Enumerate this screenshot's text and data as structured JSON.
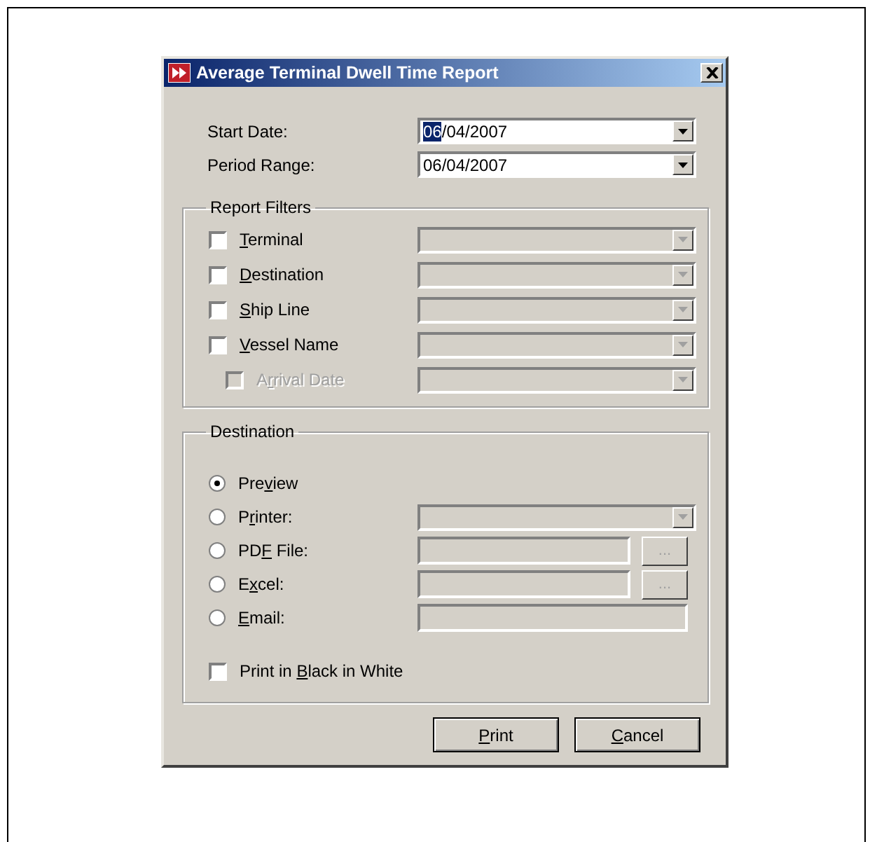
{
  "window": {
    "title": "Average Terminal Dwell Time Report"
  },
  "date_fields": [
    {
      "label": "Start Date:",
      "value_selected": "06",
      "value": "/04/2007"
    },
    {
      "label": "Period Range:",
      "value": "06/04/2007"
    }
  ],
  "report_filters": {
    "title": "Report Filters",
    "items": [
      {
        "label": {
          "key": "T",
          "post": "erminal"
        },
        "checked": false,
        "disabled": false
      },
      {
        "label": {
          "key": "D",
          "post": "estination"
        },
        "checked": false,
        "disabled": false
      },
      {
        "label": {
          "key": "S",
          "post": "hip Line"
        },
        "checked": false,
        "disabled": false
      },
      {
        "label": {
          "key": "V",
          "post": "essel Name"
        },
        "checked": false,
        "disabled": false,
        "children": [
          {
            "label": {
              "pre": "A",
              "key": "r",
              "post": "rival Date"
            },
            "checked": false,
            "disabled": true
          }
        ]
      }
    ]
  },
  "destination": {
    "title": "Destination",
    "options": [
      {
        "kind": "plain",
        "label": {
          "pre": "Pre",
          "key": "v",
          "post": "iew"
        },
        "selected": true
      },
      {
        "kind": "combo",
        "label": {
          "pre": "P",
          "key": "r",
          "post": "inter:"
        },
        "selected": false
      },
      {
        "kind": "browse",
        "label": {
          "pre": "PD",
          "key": "F",
          "post": " File:"
        },
        "selected": false,
        "browse_label": "..."
      },
      {
        "kind": "browse",
        "label": {
          "pre": "E",
          "key": "x",
          "post": "cel:"
        },
        "selected": false,
        "browse_label": "..."
      },
      {
        "kind": "text",
        "label": {
          "key": "E",
          "post": "mail:"
        },
        "selected": false
      }
    ],
    "bw_checkbox": {
      "label": {
        "pre": "Print in ",
        "key": "B",
        "post": "lack in White"
      },
      "checked": false
    }
  },
  "buttons": [
    {
      "label": {
        "key": "P",
        "post": "rint"
      }
    },
    {
      "label": {
        "key": "C",
        "post": "ancel"
      }
    }
  ]
}
